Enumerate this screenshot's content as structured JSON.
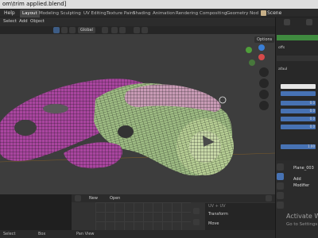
{
  "title_bar": {
    "text": "om\\trim applied.blend]"
  },
  "menubar": {
    "file": "Help",
    "tabs": [
      "Layout",
      "Modeling",
      "Sculpting",
      "UV Editing",
      "Texture Paint",
      "Shading",
      "Animation",
      "Rendering",
      "Compositing",
      "Geometry Nod"
    ],
    "active_tab": "Layout",
    "scene": "Scene"
  },
  "viewport_header": {
    "items": [
      "Select",
      "Add",
      "Object"
    ],
    "orientation": "Global",
    "options": "Options"
  },
  "editor_header": {
    "new": "New",
    "open": "Open"
  },
  "transform_panel": {
    "title": "Transform",
    "sub": "UV + UV",
    "move": "Move"
  },
  "statusbar": {
    "select": "Select",
    "box": "Box",
    "view": "Pan View"
  },
  "properties": {
    "object_name": "Plane_003",
    "add_modifier": "Add Modifier"
  },
  "outliner": {
    "rows": [
      "",
      "offs",
      "",
      "afaul",
      "",
      "",
      "0.0",
      "0.0",
      "0.0",
      "0.0",
      "1.00"
    ]
  },
  "watermark": {
    "title": "Activate Wind",
    "subtitle": "Go to Settings to"
  },
  "colors": {
    "accent_blue": "#4772b3",
    "active_green": "#3f8a3f",
    "mesh_magenta": "#b04aa8",
    "mesh_green": "#a8c486",
    "mesh_wire": "#111111"
  },
  "icons": [
    "blender-logo",
    "scene-icon",
    "hand-icon",
    "zoom-icon",
    "camera-icon",
    "grid-icon"
  ]
}
